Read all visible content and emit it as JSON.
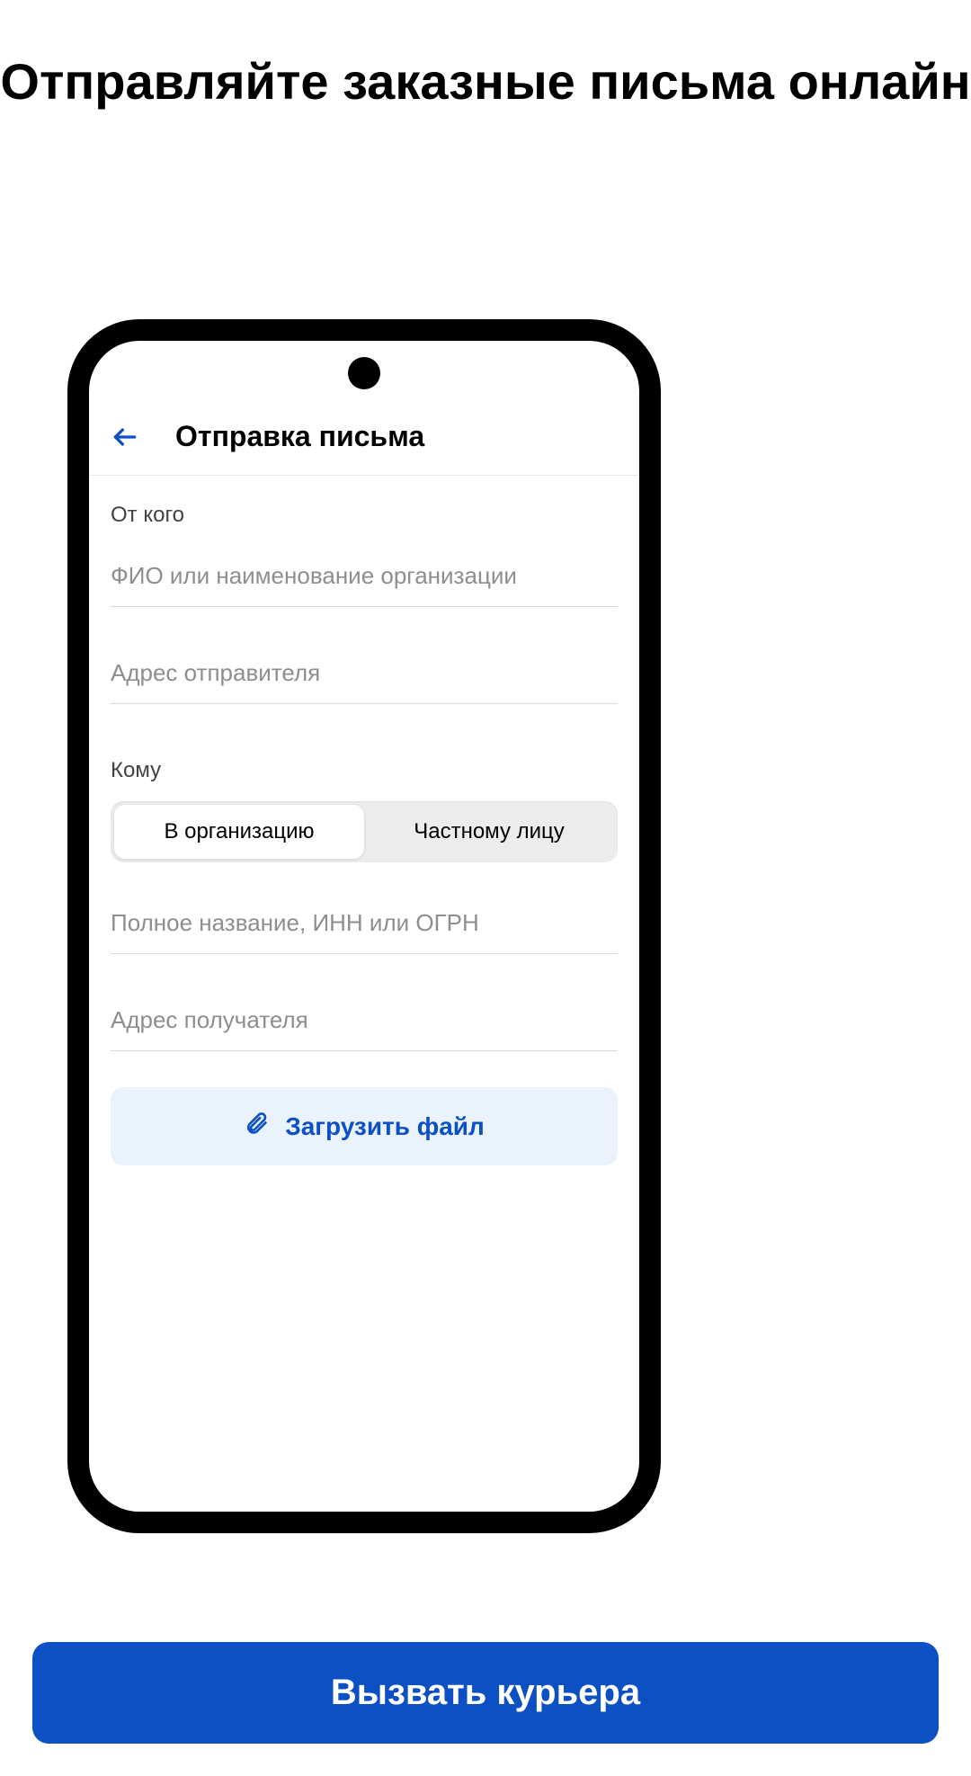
{
  "promo": {
    "title": "Отправляйте заказные письма онлайн"
  },
  "appbar": {
    "title": "Отправка письма"
  },
  "sender": {
    "label": "От кого",
    "name_ph": "ФИО или наименование организации",
    "addr_ph": "Адрес отправителя"
  },
  "recipient": {
    "label": "Кому",
    "tab_org": "В организацию",
    "tab_person": "Частному лицу",
    "org_ph": "Полное название, ИНН или ОГРН",
    "addr_ph": "Адрес получателя"
  },
  "upload": {
    "label": "Загрузить файл"
  },
  "cta": {
    "label": "Вызвать курьера"
  },
  "colors": {
    "accent": "#0d50c3"
  }
}
